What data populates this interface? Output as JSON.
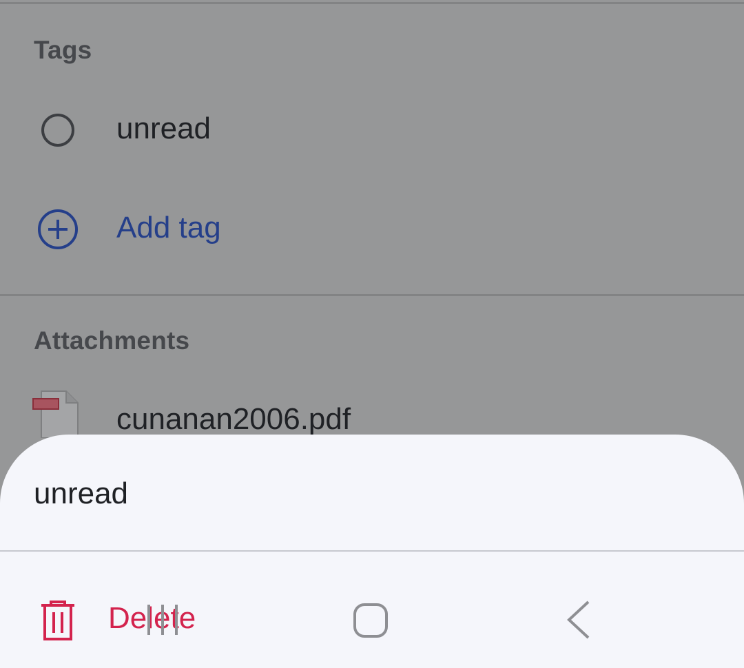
{
  "sections": {
    "tags": {
      "heading": "Tags",
      "items": [
        {
          "label": "unread",
          "icon": "radio-unchecked-icon"
        }
      ],
      "add_tag": {
        "label": "Add tag",
        "icon": "add-circle-icon"
      }
    },
    "attachments": {
      "heading": "Attachments",
      "items": [
        {
          "label": "cunanan2006.pdf",
          "icon": "pdf-file-icon"
        }
      ]
    }
  },
  "bottom_sheet": {
    "title": "unread",
    "actions": [
      {
        "label": "Delete",
        "icon": "trash-icon"
      }
    ]
  },
  "nav_bar": {
    "buttons": [
      "recents-icon",
      "home-icon",
      "back-icon"
    ]
  },
  "colors": {
    "scrim_background": "#969798",
    "sheet_background": "#f5f6fb",
    "accent_blue": "#253f8a",
    "delete_red": "#d3234d",
    "text_dark": "#1f2125",
    "heading_gray": "#46484c"
  }
}
